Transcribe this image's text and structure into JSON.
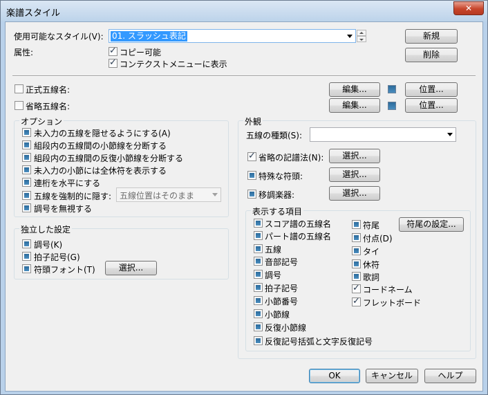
{
  "window": {
    "title": "楽譜スタイル",
    "close_label": "✕"
  },
  "style": {
    "label": "使用可能なスタイル(V):",
    "value": "01. スラッシュ表記",
    "new_button": "新規",
    "delete_button": "削除",
    "attr_label": "属性:",
    "copy_label": "コピー可能",
    "context_label": "コンテクストメニューに表示"
  },
  "staff_names": {
    "full_label": "正式五線名:",
    "abbr_label": "省略五線名:",
    "edit_button": "編集...",
    "position_button": "位置..."
  },
  "options": {
    "title": "オプション",
    "items": [
      "未入力の五線を隠せるようにする(A)",
      "組段内の五線間の小節線を分断する",
      "組段内の五線間の反復小節線を分断する",
      "未入力の小節には全休符を表示する",
      "連桁を水平にする",
      "五線を強制的に隠す:",
      "調号を無視する"
    ],
    "hide_combo": "五線位置はそのまま"
  },
  "independent": {
    "title": "独立した設定",
    "key_label": "調号(K)",
    "time_label": "拍子記号(G)",
    "notehead_label": "符頭フォント(T)",
    "select_button": "選択..."
  },
  "appearance": {
    "title": "外観",
    "staff_type_label": "五線の種類(S):",
    "staff_type_value": "",
    "abbrev_label": "省略の記譜法(N):",
    "special_label": "特殊な符頭:",
    "transpose_label": "移調楽器:",
    "select_button": "選択..."
  },
  "display_items": {
    "title": "表示する項目",
    "left": [
      "スコア譜の五線名",
      "パート譜の五線名",
      "五線",
      "音部記号",
      "調号",
      "拍子記号",
      "小節番号",
      "小節線",
      "反復小節線",
      "反復記号括弧と文字反復記号"
    ],
    "right": [
      "符尾",
      "付点(D)",
      "タイ",
      "休符",
      "歌詞",
      "コードネーム",
      "フレットボード"
    ],
    "stem_button": "符尾の設定..."
  },
  "footer": {
    "ok": "OK",
    "cancel": "キャンセル",
    "help": "ヘルプ"
  }
}
